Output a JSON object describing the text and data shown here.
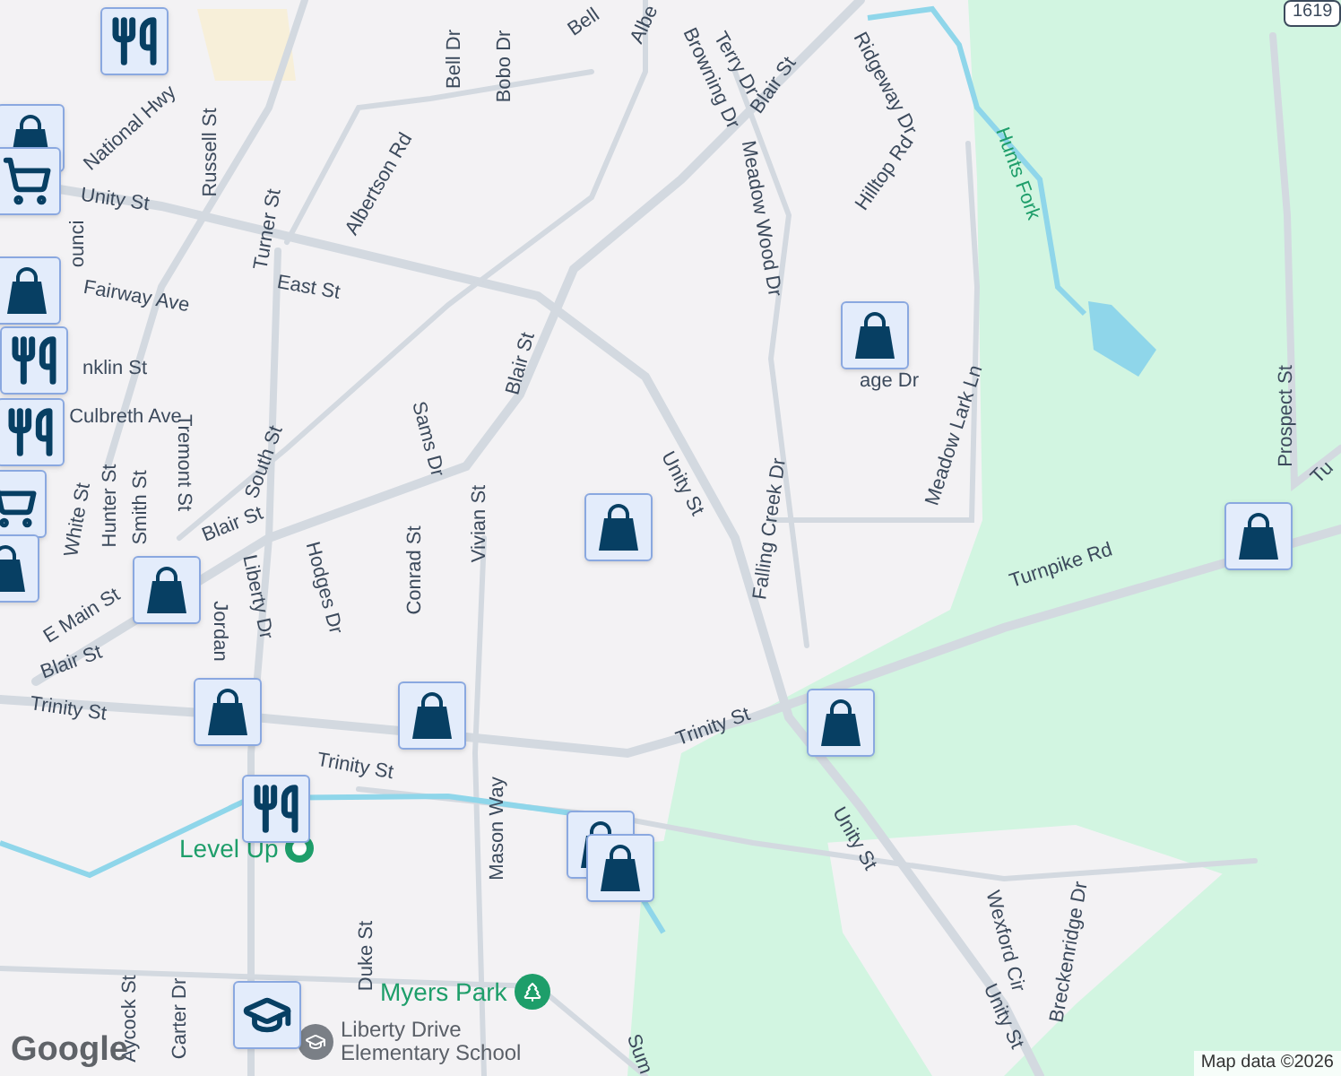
{
  "map": {
    "street_labels": [
      {
        "text": "National Hwy"
      },
      {
        "text": "Unity St"
      },
      {
        "text": "Russell St"
      },
      {
        "text": "Turner St"
      },
      {
        "text": "Albertson Rd"
      },
      {
        "text": "Bell Dr"
      },
      {
        "text": "Bobo Dr"
      },
      {
        "text": "Bell"
      },
      {
        "text": "Albe"
      },
      {
        "text": "East St"
      },
      {
        "text": "Fairway Ave"
      },
      {
        "text": "nklin St"
      },
      {
        "text": "Culbreth Ave"
      },
      {
        "text": "Tremont St"
      },
      {
        "text": "South St"
      },
      {
        "text": "Sams Dr"
      },
      {
        "text": "Blair St"
      },
      {
        "text": "Vivian St"
      },
      {
        "text": "Smith St"
      },
      {
        "text": "Hunter St"
      },
      {
        "text": "White St"
      },
      {
        "text": "Unity St"
      },
      {
        "text": "Blair St"
      },
      {
        "text": "Browning Dr"
      },
      {
        "text": "Terry Dr"
      },
      {
        "text": "Meadow Wood Dr"
      },
      {
        "text": "Ridgeway Dr"
      },
      {
        "text": "Hilltop Rd"
      },
      {
        "text": "age Dr"
      },
      {
        "text": "Meadow Lark Ln"
      },
      {
        "text": "Falling Creek Dr"
      },
      {
        "text": "Prospect St"
      },
      {
        "text": "Tu"
      },
      {
        "text": "Blair St"
      },
      {
        "text": "E Main St"
      },
      {
        "text": "Blair St"
      },
      {
        "text": "Liberty Dr"
      },
      {
        "text": "Hodges Dr"
      },
      {
        "text": "Conrad St"
      },
      {
        "text": "Jordan"
      },
      {
        "text": "Trinity St"
      },
      {
        "text": "Trinity St"
      },
      {
        "text": "Trinity St"
      },
      {
        "text": "Turnpike Rd"
      },
      {
        "text": "Unity St"
      },
      {
        "text": "Unity St"
      },
      {
        "text": "Wexford Cir"
      },
      {
        "text": "Breckenridge Dr"
      },
      {
        "text": "Mason Way"
      },
      {
        "text": "Duke St"
      },
      {
        "text": "Aycock St"
      },
      {
        "text": "Carter Dr"
      },
      {
        "text": "Sum"
      },
      {
        "text": "ounci"
      }
    ],
    "water_label": "Hunts Fork",
    "route_shield": "1619",
    "places": [
      {
        "name": "Level Up",
        "kind": "food"
      },
      {
        "name": "Myers Park",
        "kind": "park"
      },
      {
        "name": "Liberty Drive Elementary School",
        "kind": "school"
      }
    ],
    "markers": [
      {
        "kind": "restaurant"
      },
      {
        "kind": "shopping"
      },
      {
        "kind": "grocery"
      },
      {
        "kind": "shopping"
      },
      {
        "kind": "restaurant"
      },
      {
        "kind": "restaurant"
      },
      {
        "kind": "grocery"
      },
      {
        "kind": "shopping"
      },
      {
        "kind": "shopping"
      },
      {
        "kind": "shopping"
      },
      {
        "kind": "shopping"
      },
      {
        "kind": "shopping"
      },
      {
        "kind": "restaurant"
      },
      {
        "kind": "shopping"
      },
      {
        "kind": "shopping"
      },
      {
        "kind": "shopping"
      },
      {
        "kind": "shopping"
      },
      {
        "kind": "shopping"
      },
      {
        "kind": "school"
      }
    ],
    "logo": "Google",
    "attribution": "Map data ©2026"
  }
}
